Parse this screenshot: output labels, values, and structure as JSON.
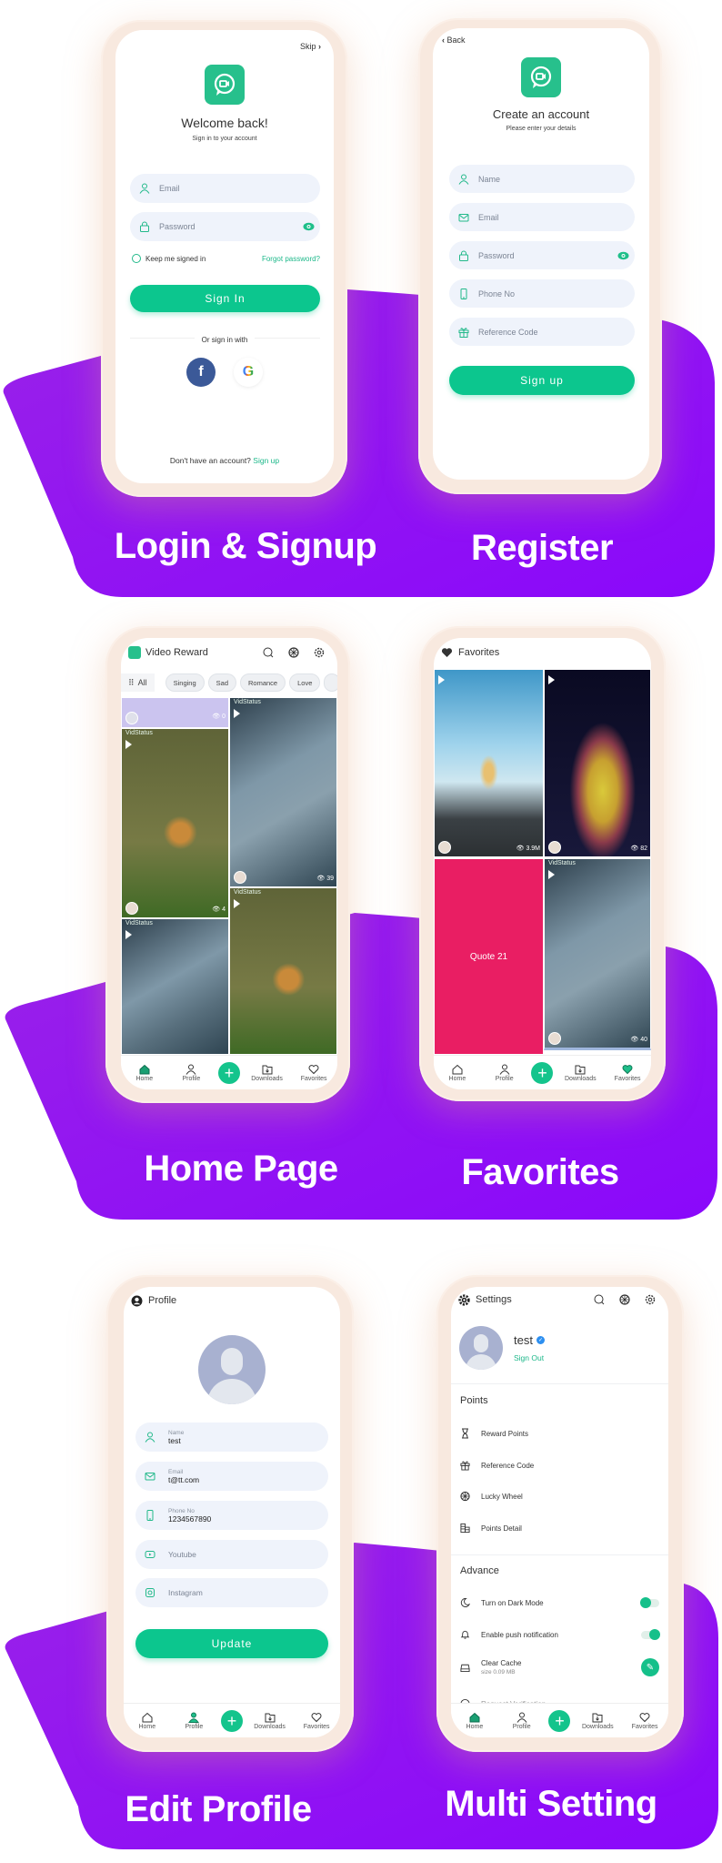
{
  "captions": {
    "login": "Login & Signup",
    "register": "Register",
    "home": "Home Page",
    "favorites": "Favorites",
    "edit_profile": "Edit Profile",
    "settings": "Multi Setting"
  },
  "colors": {
    "primary_green": "#0cc68e",
    "purple_band": "#9112f2",
    "input_bg": "#eff3fb",
    "quote_pink": "#e91e63",
    "facebook_blue": "#3b5998"
  },
  "login": {
    "skip": "Skip",
    "title": "Welcome back!",
    "subtitle": "Sign in to your account",
    "email_placeholder": "Email",
    "password_placeholder": "Password",
    "keep_signed_in": "Keep me signed in",
    "forgot_password": "Forgot password?",
    "sign_in": "Sign In",
    "or_sign_in_with": "Or sign in with",
    "no_account": "Don't have an account?",
    "sign_up_link": "Sign up"
  },
  "register": {
    "back": "Back",
    "title": "Create an account",
    "subtitle": "Please enter your details",
    "name_placeholder": "Name",
    "email_placeholder": "Email",
    "password_placeholder": "Password",
    "phone_placeholder": "Phone No",
    "reference_placeholder": "Reference Code",
    "sign_up": "Sign up"
  },
  "nav": {
    "home": "Home",
    "profile": "Profile",
    "downloads": "Downloads",
    "favorites": "Favorites"
  },
  "home": {
    "app_title": "Video Reward",
    "chips": [
      "All",
      "Singing",
      "Sad",
      "Romance",
      "Love"
    ],
    "watermark": "VidStatus",
    "tiles": [
      {
        "views": "0"
      },
      {
        "views": "4"
      },
      {
        "views": "39"
      }
    ]
  },
  "favorites": {
    "title": "Favorites",
    "tiles": [
      {
        "views": "3.9M"
      },
      {
        "views": "82"
      },
      {
        "quote": "Quote 21"
      },
      {
        "watermark": "VidStatus",
        "views": "40"
      }
    ]
  },
  "profile": {
    "title": "Profile",
    "name_label": "Name",
    "name_value": "test",
    "email_label": "Email",
    "email_value": "t@tt.com",
    "phone_label": "Phone No",
    "phone_value": "1234567890",
    "youtube_placeholder": "Youtube",
    "instagram_placeholder": "Instagram",
    "update": "Update"
  },
  "settings": {
    "title": "Settings",
    "username": "test",
    "sign_out": "Sign Out",
    "points_header": "Points",
    "points_items": [
      "Reward Points",
      "Reference Code",
      "Lucky Wheel",
      "Points Detail"
    ],
    "advance_header": "Advance",
    "dark_mode": {
      "label": "Turn on Dark Mode",
      "on": false
    },
    "push_notification": {
      "label": "Enable push notification",
      "on": true
    },
    "clear_cache": {
      "label": "Clear Cache",
      "size": "size 0.09 MB"
    },
    "request_verification": "Request Verification"
  }
}
